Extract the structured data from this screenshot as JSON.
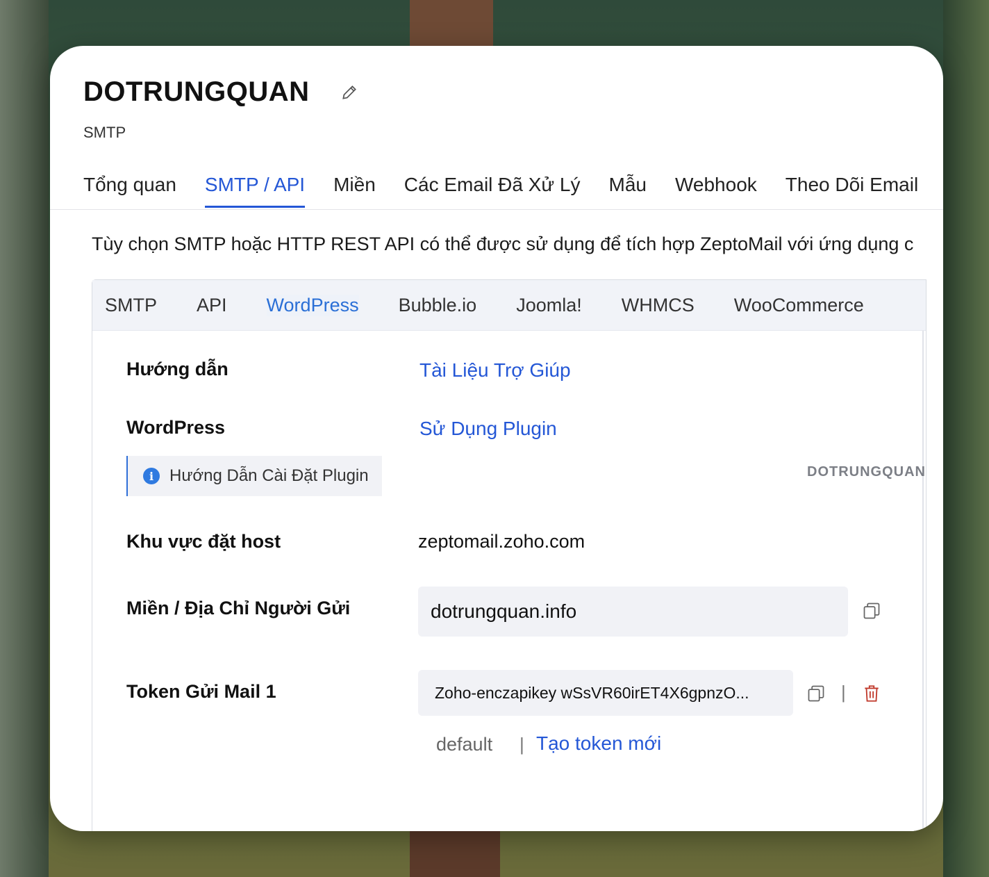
{
  "header": {
    "title": "DOTRUNGQUAN",
    "subtitle": "SMTP",
    "edit_icon": "pencil-icon"
  },
  "tabs": [
    {
      "label": "Tổng quan",
      "active": false
    },
    {
      "label": "SMTP / API",
      "active": true
    },
    {
      "label": "Miền",
      "active": false
    },
    {
      "label": "Các Email Đã Xử Lý",
      "active": false
    },
    {
      "label": "Mẫu",
      "active": false
    },
    {
      "label": "Webhook",
      "active": false
    },
    {
      "label": "Theo Dõi Email",
      "active": false
    }
  ],
  "description": "Tùy chọn SMTP hoặc HTTP REST API có thể được sử dụng để tích hợp ZeptoMail với ứng dụng c",
  "subtabs": [
    {
      "label": "SMTP",
      "active": false
    },
    {
      "label": "API",
      "active": false
    },
    {
      "label": "WordPress",
      "active": true
    },
    {
      "label": "Bubble.io",
      "active": false
    },
    {
      "label": "Joomla!",
      "active": false
    },
    {
      "label": "WHMCS",
      "active": false
    },
    {
      "label": "WooCommerce",
      "active": false
    }
  ],
  "wordpress": {
    "guide_label": "Hướng dẫn",
    "guide_link": "Tài Liệu Trợ Giúp",
    "wordpress_label": "WordPress",
    "plugin_link": "Sử Dụng Plugin",
    "plugin_install_guide": "Hướng Dẫn Cài Đặt Plugin",
    "watermark": "DOTRUNGQUAN",
    "host_region_label": "Khu vực đặt host",
    "host_region_value": "zeptomail.zoho.com",
    "sender_label": "Miền / Địa Chỉ Người Gửi",
    "sender_value": "dotrungquan.info",
    "token_label": "Token Gửi Mail 1",
    "token_value": "Zoho-enczapikey wSsVR60irET4X6gpnzO...",
    "token_name": "default",
    "separator": "|",
    "new_token_link": "Tạo token mới"
  },
  "colors": {
    "accent": "#2457d6",
    "delete": "#c0392b",
    "info": "#2f7ae0"
  }
}
